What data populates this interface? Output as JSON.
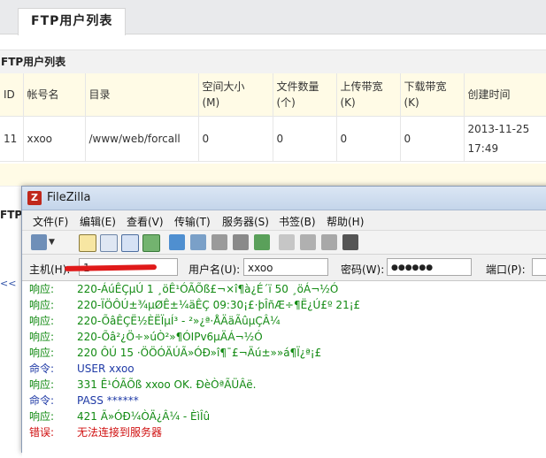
{
  "web": {
    "tab_label": "FTP用户列表",
    "section_title": "FTP用户列表",
    "section_title2": "FTP",
    "sidebar_link": "<<",
    "table": {
      "headers": [
        "ID",
        "帐号名",
        "目录",
        "空间大小\n(M)",
        "文件数量\n(个)",
        "上传带宽\n(K)",
        "下载带宽\n(K)",
        "创建时间"
      ],
      "rows": [
        [
          "11",
          "xxoo",
          "/www/web/forcall",
          "0",
          "0",
          "0",
          "0",
          "2013-11-25\n17:49"
        ]
      ]
    }
  },
  "filezilla": {
    "title": "FileZilla",
    "menu": [
      {
        "label": "文件(F)"
      },
      {
        "label": "编辑(E)"
      },
      {
        "label": "查看(V)"
      },
      {
        "label": "传输(T)"
      },
      {
        "label": "服务器(S)"
      },
      {
        "label": "书签(B)"
      },
      {
        "label": "帮助(H)"
      }
    ],
    "quickconnect": {
      "host_label": "主机(H):",
      "host_value": "1",
      "user_label": "用户名(U):",
      "user_value": "xxoo",
      "pass_label": "密码(W):",
      "pass_value": "●●●●●●",
      "port_label": "端口(P):",
      "port_value": ""
    },
    "log": [
      {
        "type": "响应:",
        "kind": "resp",
        "msg": "220-ÁúÊÇµÚ 1 ¸öÊ¹ÓÃÕß£¬×î¶à¿É´ï 50 ¸öÁ¬½Ó"
      },
      {
        "type": "响应:",
        "kind": "resp",
        "msg": "220-ÏÖÔÚ±¾µØÊ±¼äÊÇ 09:30¡£·þÎñÆ÷¶Ë¿Ú£º 21¡£"
      },
      {
        "type": "响应:",
        "kind": "resp",
        "msg": "220-ÕâÊÇË½ÈËÏµÍ³ - ²»¿ª·ÅÄäÃûµÇÂ¼"
      },
      {
        "type": "响应:",
        "kind": "resp",
        "msg": "220-Õâ²¿Ö÷»úÒ²»¶Ó­IPv6µÄÁ¬½Ó"
      },
      {
        "type": "响应:",
        "kind": "resp",
        "msg": "220 ÔÚ 15 ·ÖÖÓÄÚÃ»ÓÐ»î¶¯£¬Äú±»»á¶Ï¿ª¡£"
      },
      {
        "type": "命令:",
        "kind": "cmd",
        "msg": "USER xxoo"
      },
      {
        "type": "响应:",
        "kind": "resp",
        "msg": "331 Ê¹ÓÃÕß xxoo OK. ÐèÒªÃÜÂë."
      },
      {
        "type": "命令:",
        "kind": "cmd",
        "msg": "PASS ******"
      },
      {
        "type": "响应:",
        "kind": "resp",
        "msg": "421 Ã»ÓÐ¼ÒÄ¿Â¼ - ÈìÎû"
      },
      {
        "type": "错误:",
        "kind": "err",
        "msg": "无法连接到服务器"
      }
    ]
  },
  "colors": {
    "response": "#128a12",
    "command": "#1f3aa6",
    "error": "#d01010",
    "header_bg": "#fffbe6"
  }
}
